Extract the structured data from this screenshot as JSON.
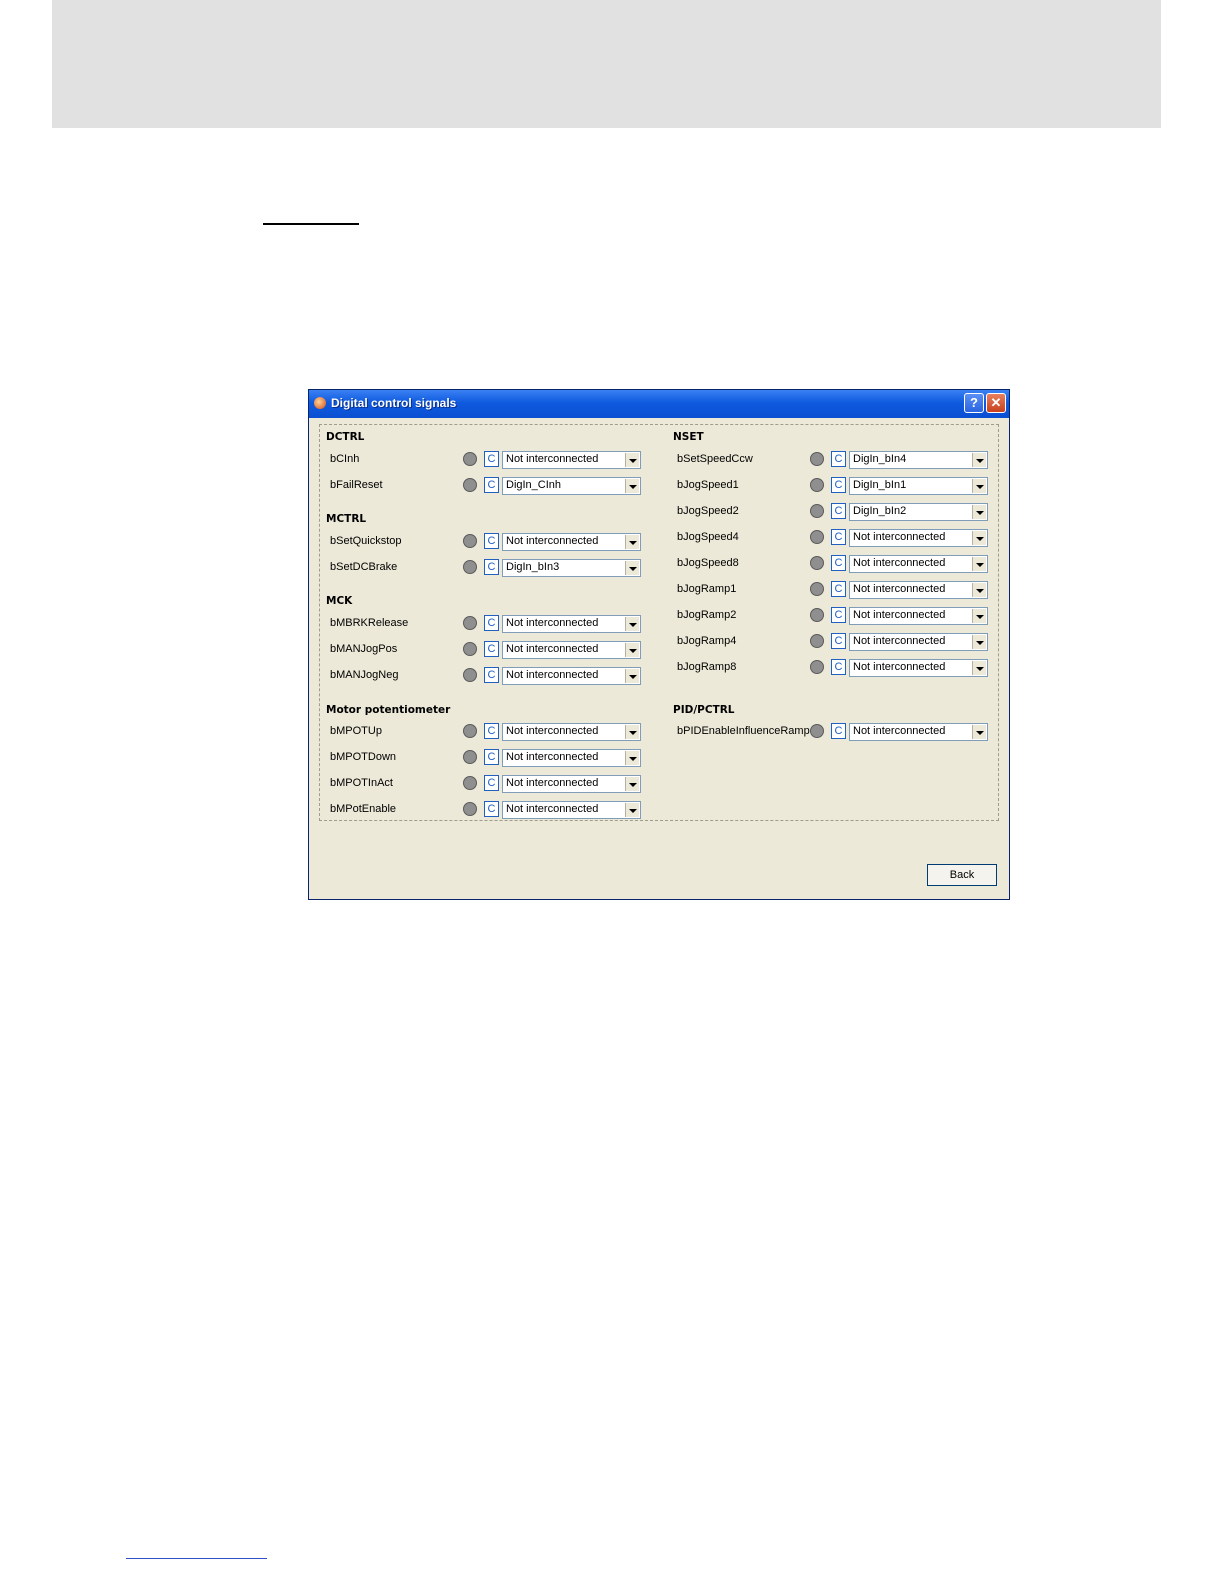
{
  "dialog": {
    "title": "Digital control signals",
    "help_label": "?",
    "close_label": "✕",
    "back_label": "Back"
  },
  "left": {
    "dctrl": {
      "title": "DCTRL",
      "rows": [
        {
          "label": "bCInh",
          "value": "Not interconnected"
        },
        {
          "label": "bFailReset",
          "value": "DigIn_CInh"
        }
      ]
    },
    "mctrl": {
      "title": "MCTRL",
      "rows": [
        {
          "label": "bSetQuickstop",
          "value": "Not interconnected"
        },
        {
          "label": "bSetDCBrake",
          "value": "DigIn_bIn3"
        }
      ]
    },
    "mck": {
      "title": "MCK",
      "rows": [
        {
          "label": "bMBRKRelease",
          "value": "Not interconnected"
        },
        {
          "label": "bMANJogPos",
          "value": "Not interconnected"
        },
        {
          "label": "bMANJogNeg",
          "value": "Not interconnected"
        }
      ]
    },
    "mpot": {
      "title": "Motor potentiometer",
      "rows": [
        {
          "label": "bMPOTUp",
          "value": "Not interconnected"
        },
        {
          "label": "bMPOTDown",
          "value": "Not interconnected"
        },
        {
          "label": "bMPOTInAct",
          "value": "Not interconnected"
        },
        {
          "label": "bMPotEnable",
          "value": "Not interconnected"
        }
      ]
    }
  },
  "right": {
    "nset": {
      "title": "NSET",
      "rows": [
        {
          "label": "bSetSpeedCcw",
          "value": "DigIn_bIn4"
        },
        {
          "label": "bJogSpeed1",
          "value": "DigIn_bIn1"
        },
        {
          "label": "bJogSpeed2",
          "value": "DigIn_bIn2"
        },
        {
          "label": "bJogSpeed4",
          "value": "Not interconnected"
        },
        {
          "label": "bJogSpeed8",
          "value": "Not interconnected"
        },
        {
          "label": "bJogRamp1",
          "value": "Not interconnected"
        },
        {
          "label": "bJogRamp2",
          "value": "Not interconnected"
        },
        {
          "label": "bJogRamp4",
          "value": "Not interconnected"
        },
        {
          "label": "bJogRamp8",
          "value": "Not interconnected"
        }
      ]
    },
    "pid": {
      "title": "PID/PCTRL",
      "rows": [
        {
          "label": "bPIDEnableInfluenceRamp",
          "value": "Not interconnected"
        }
      ]
    }
  },
  "c_label": "C"
}
